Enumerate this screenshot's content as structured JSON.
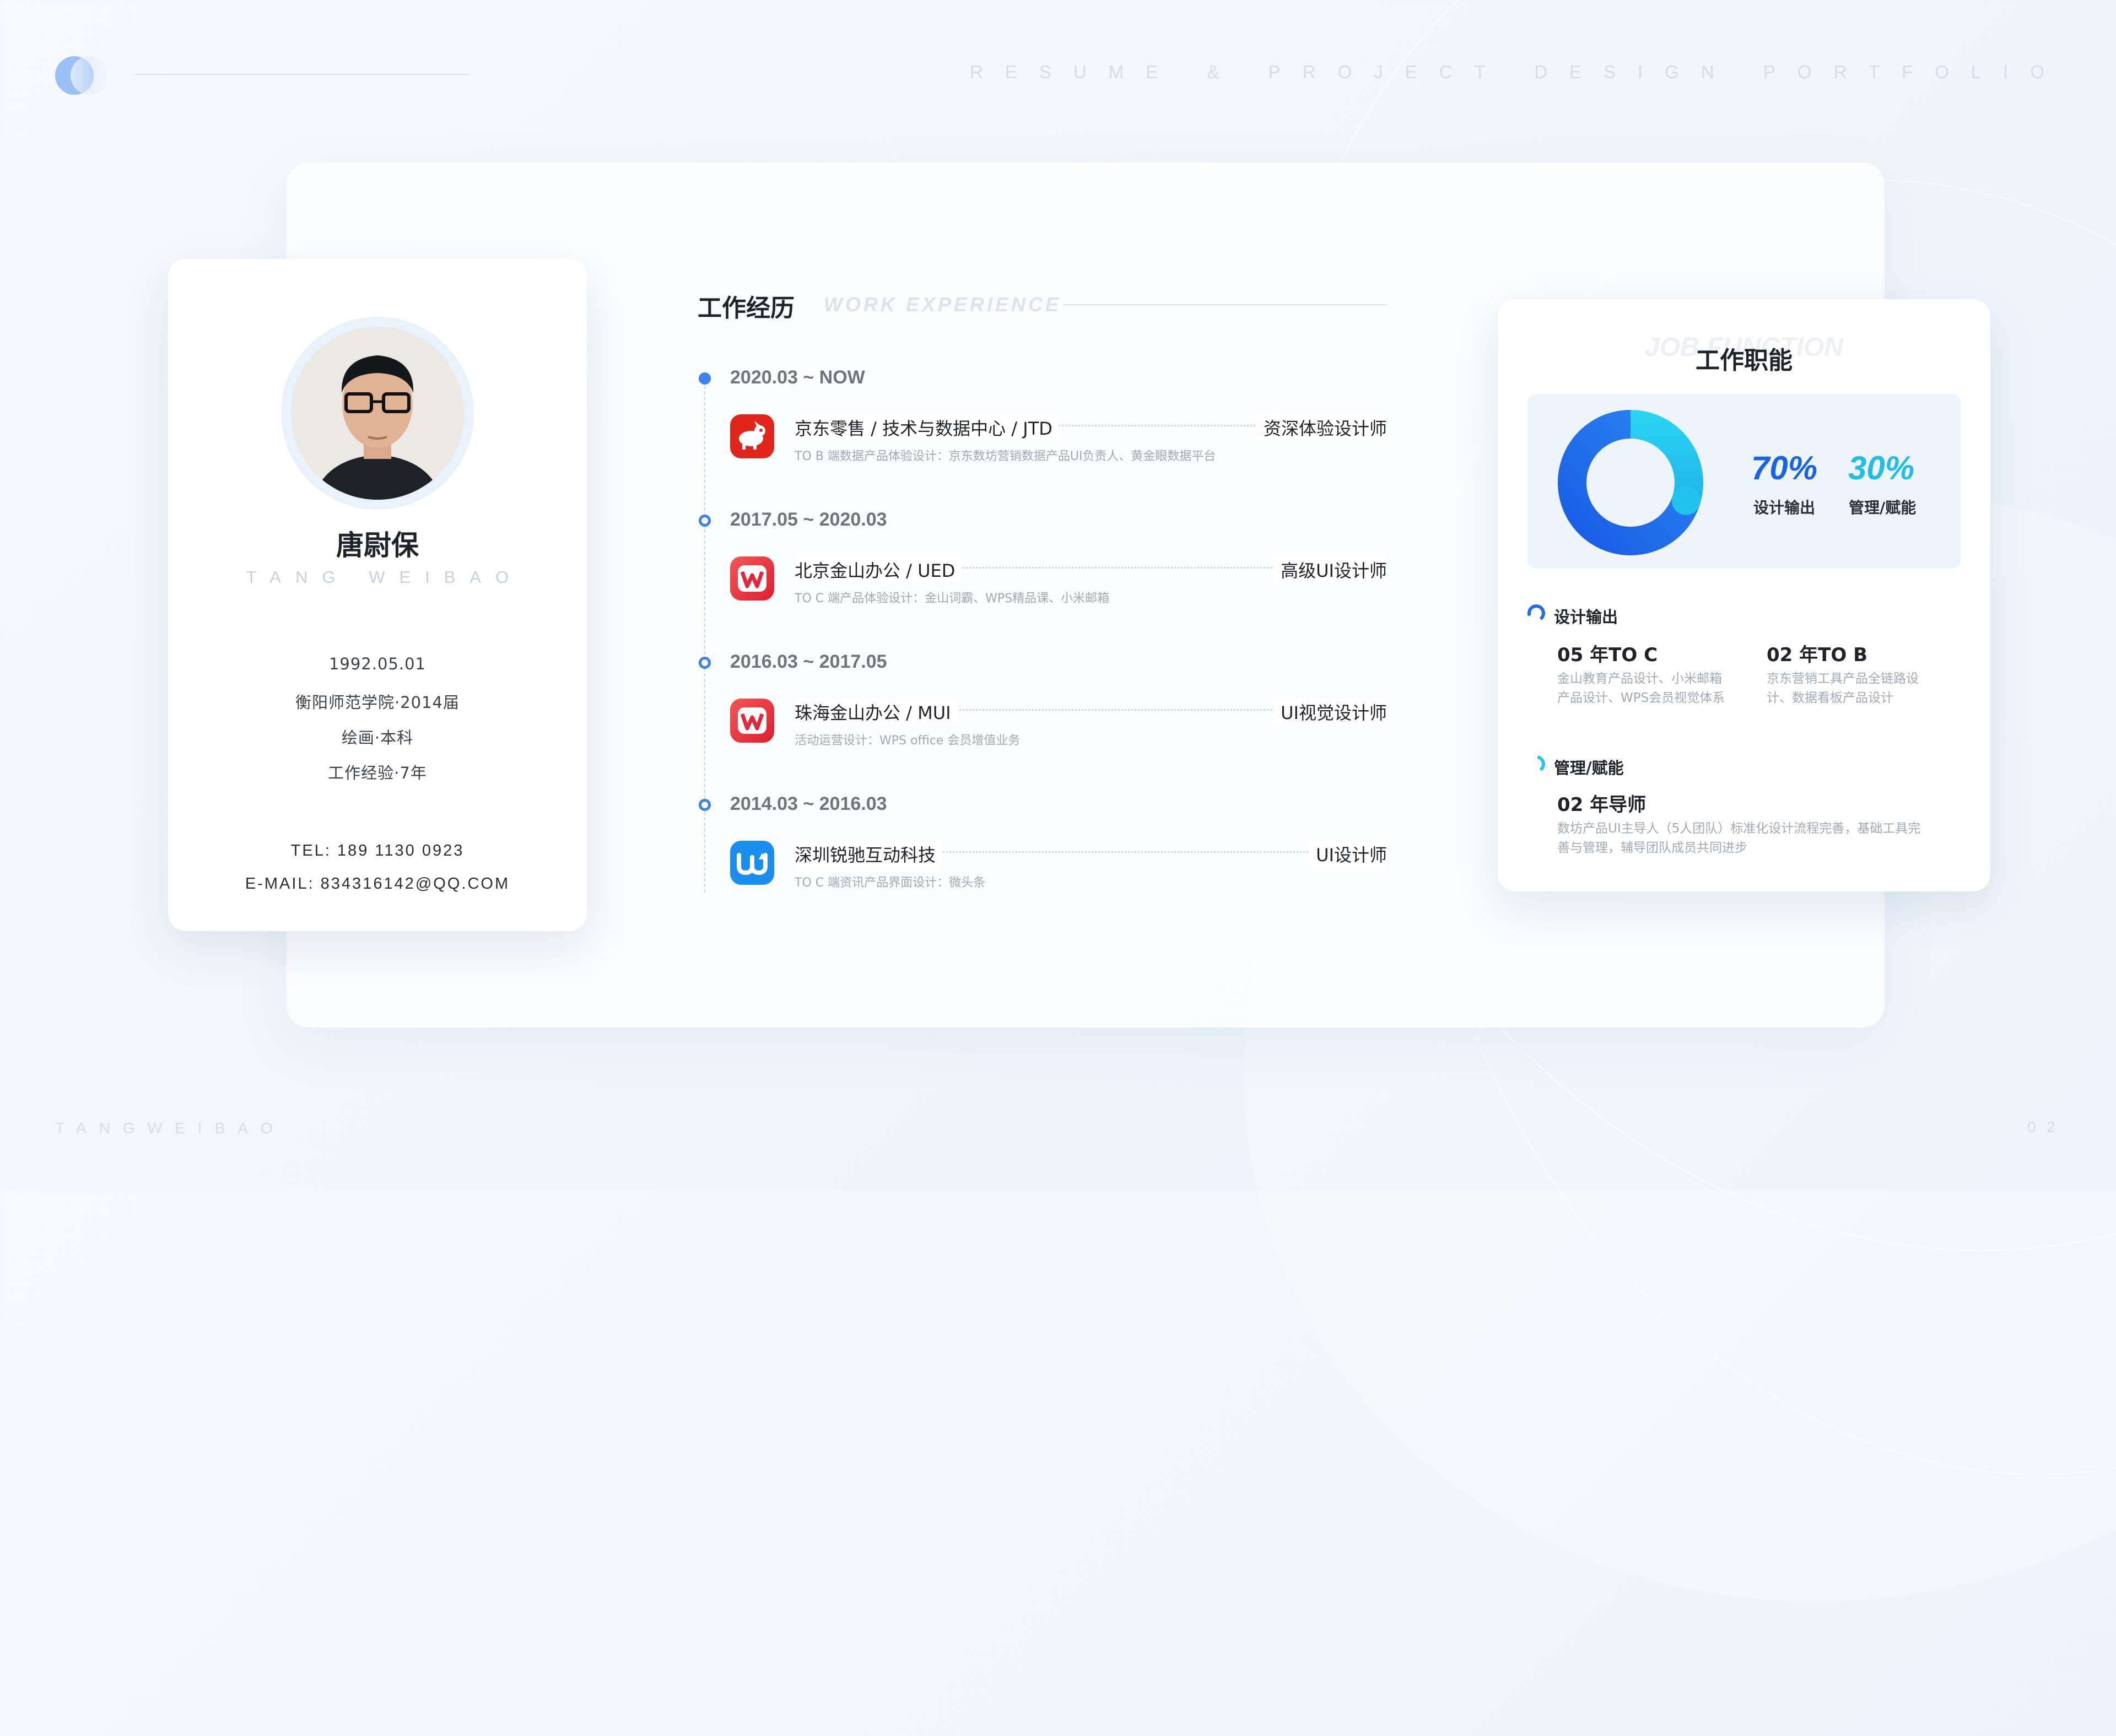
{
  "header": {
    "subtitle": "RESUME & PROJECT DESIGN PORTFOLIO"
  },
  "footer": {
    "name": "TANGWEIBAO",
    "page": "02"
  },
  "profile": {
    "name": "唐尉保",
    "pinyin": "TANG WEIBAO",
    "birth": "1992.05.01",
    "school": "衡阳师范学院·2014届",
    "major": "绘画·本科",
    "experience": "工作经验·7年",
    "tel": "TEL: 189 1130 0923",
    "email": "E-MAIL: 834316142@QQ.COM"
  },
  "work": {
    "title": "工作经历",
    "title_en": "WORK EXPERIENCE",
    "items": [
      {
        "date": "2020.03 ~ NOW",
        "company": "京东零售 / 技术与数据中心 / JTD",
        "role": "资深体验设计师",
        "desc": "TO B 端数据产品体验设计：京东数坊营销数据产品UI负责人、黄金眼数据平台",
        "icon": "jd-joy-icon"
      },
      {
        "date": "2017.05 ~ 2020.03",
        "company": "北京金山办公 / UED",
        "role": "高级UI设计师",
        "desc": "TO C 端产品体验设计：金山词霸、WPS精品课、小米邮箱",
        "icon": "wps-icon"
      },
      {
        "date": "2016.03 ~ 2017.05",
        "company": "珠海金山办公 / MUI",
        "role": "UI视觉设计师",
        "desc": "活动运营设计：WPS office 会员增值业务",
        "icon": "wps-icon"
      },
      {
        "date": "2014.03 ~ 2016.03",
        "company": "深圳锐驰互动科技",
        "role": "UI设计师",
        "desc": "TO C 端资讯产品界面设计：微头条",
        "icon": "weitoutiao-icon"
      }
    ]
  },
  "job_function": {
    "title_en": "JOB FUNCTION",
    "title": "工作职能",
    "design_percent": "70%",
    "design_label": "设计输出",
    "mgmt_percent": "30%",
    "mgmt_label": "管理/赋能",
    "colors": {
      "primary": "#1f6ee8",
      "secondary": "#25c6ee"
    },
    "design_section": {
      "title": "设计输出",
      "toc_head": "05 年TO C",
      "toc_desc": "金山教育产品设计、小米邮箱产品设计、WPS会员视觉体系",
      "tob_head": "02 年TO B",
      "tob_desc": "京东营销工具产品全链路设计、数据看板产品设计"
    },
    "mgmt_section": {
      "title": "管理/赋能",
      "head": "02 年导师",
      "desc": "数坊产品UI主导人（5人团队）标准化设计流程完善，基础工具完善与管理，辅导团队成员共同进步"
    }
  },
  "chart_data": {
    "type": "pie",
    "categories": [
      "设计输出",
      "管理/赋能"
    ],
    "values": [
      70,
      30
    ],
    "title": ""
  }
}
